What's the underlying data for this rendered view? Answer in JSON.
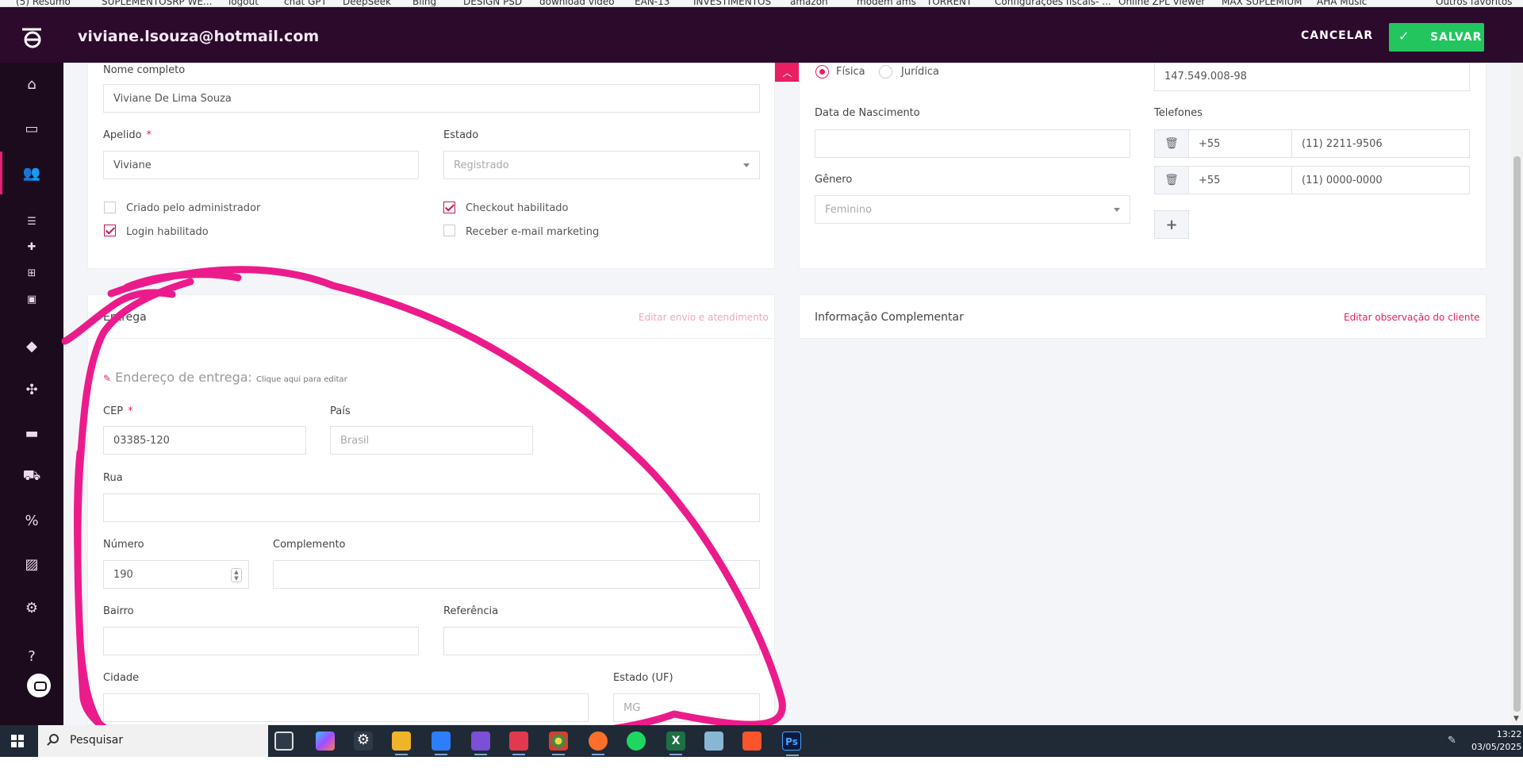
{
  "bookmarks": [
    "(5) Resumo",
    "SUPLEMENTOSRP WE...",
    "logout",
    "chat GPT",
    "DeepSeek",
    "Bling",
    "DESIGN PSD",
    "download video",
    "EAN-13",
    "INVESTIMENTOS",
    "amazon",
    "modem ams",
    "TORRENT",
    "Configurações fiscais- ...",
    "Online ZPL Viewer",
    "MAX SUPLEMIUM",
    "AHA Music",
    "Outros favoritos"
  ],
  "header": {
    "email": "viviane.lsouza@hotmail.com",
    "cancel_label": "CANCELAR",
    "save_label": "SALVAR",
    "save_color": "#22c55e",
    "bg_color": "#2b0a2c"
  },
  "sidebar": {
    "icons": [
      "home-icon",
      "inbox-icon",
      "users-icon",
      "list-icon",
      "plus-icon",
      "bank-icon",
      "cash-icon",
      "tag-icon",
      "puzzle-icon",
      "credit-card-icon",
      "truck-icon",
      "percent-icon",
      "image-icon",
      "settings-icon",
      "help-icon"
    ],
    "help_label": "?"
  },
  "profile": {
    "full_name_label": "Nome completo",
    "full_name_value": "Viviane De Lima Souza",
    "nickname_label": "Apelido",
    "nickname_value": "Viviane",
    "state_label": "Estado",
    "state_value": "Registrado",
    "required_mark": "*",
    "checkboxes": [
      {
        "label": "Criado pelo administrador",
        "checked": false
      },
      {
        "label": "Login habilitado",
        "checked": true
      },
      {
        "label": "Checkout habilitado",
        "checked": true
      },
      {
        "label": "Receber e-mail marketing",
        "checked": false
      }
    ]
  },
  "person": {
    "radio_fisica": "Física",
    "radio_juridica": "Jurídica",
    "selected": "Física",
    "cpf_value": "147.549.008-98",
    "birth_label": "Data de Nascimento",
    "birth_value": "",
    "gender_label": "Gênero",
    "gender_value": "Feminino",
    "phones_label": "Telefones",
    "phones": [
      {
        "country": "+55",
        "number": "(11) 2211-9506"
      },
      {
        "country": "+55",
        "number": "(11) 0000-0000"
      }
    ],
    "add_phone_label": "+"
  },
  "delivery": {
    "title": "Entrega",
    "edit_link": "Editar envio e atendimento",
    "address_title": "Endereço de entrega:",
    "address_hint": "Clique aqui para editar",
    "cep_label": "CEP",
    "cep_value": "03385-120",
    "country_label": "País",
    "country_value": "Brasil",
    "street_label": "Rua",
    "street_value": "",
    "number_label": "Número",
    "number_value": "190",
    "complement_label": "Complemento",
    "complement_value": "",
    "neighborhood_label": "Bairro",
    "neighborhood_value": "",
    "reference_label": "Referência",
    "reference_value": "",
    "city_label": "Cidade",
    "city_value": "",
    "uf_label": "Estado (UF)",
    "uf_value": "MG"
  },
  "complement_card": {
    "title": "Informação Complementar",
    "edit_link": "Editar observação do cliente"
  },
  "taskbar": {
    "search_placeholder": "Pesquisar",
    "time": "13:22",
    "date": "03/05/2025"
  },
  "accent_color": "#e91e63",
  "annotation_color": "#ec1b8c"
}
